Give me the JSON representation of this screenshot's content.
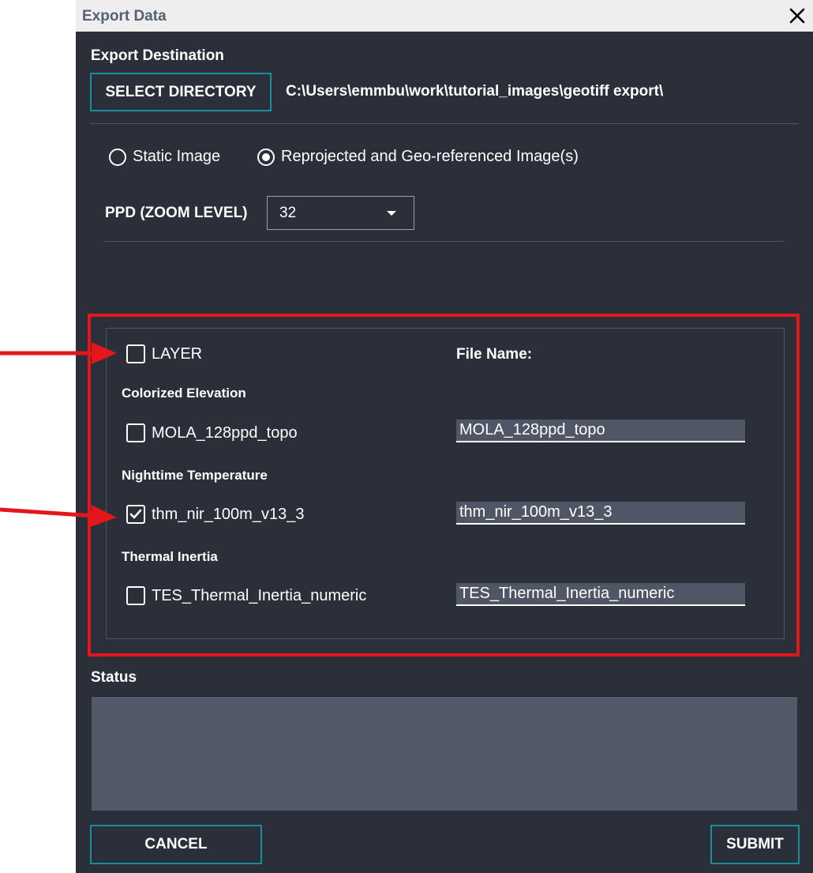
{
  "dialog": {
    "title": "Export Data"
  },
  "destination": {
    "label": "Export Destination",
    "select_button": "SELECT DIRECTORY",
    "path": "C:\\Users\\emmbu\\work\\tutorial_images\\geotiff export\\"
  },
  "image_type": {
    "options": [
      {
        "label": "Static Image",
        "checked": false
      },
      {
        "label": "Reprojected and Geo-referenced Image(s)",
        "checked": true
      }
    ]
  },
  "ppd": {
    "label": "PPD (ZOOM LEVEL)",
    "value": "32"
  },
  "layers": {
    "header_checkbox_label": "LAYER",
    "filename_header": "File Name:",
    "groups": [
      {
        "heading": "Colorized Elevation",
        "layer": "MOLA_128ppd_topo",
        "checked": false,
        "file_name": "MOLA_128ppd_topo"
      },
      {
        "heading": "Nighttime Temperature",
        "layer": "thm_nir_100m_v13_3",
        "checked": true,
        "file_name": "thm_nir_100m_v13_3"
      },
      {
        "heading": "Thermal Inertia",
        "layer": "TES_Thermal_Inertia_numeric",
        "checked": false,
        "file_name": "TES_Thermal_Inertia_numeric"
      }
    ]
  },
  "status": {
    "label": "Status",
    "text": ""
  },
  "footer": {
    "cancel": "CANCEL",
    "submit": "SUBMIT"
  },
  "colors": {
    "accent": "#1a8e9c",
    "annotation": "#e3161b",
    "background": "#2b2f3a"
  }
}
